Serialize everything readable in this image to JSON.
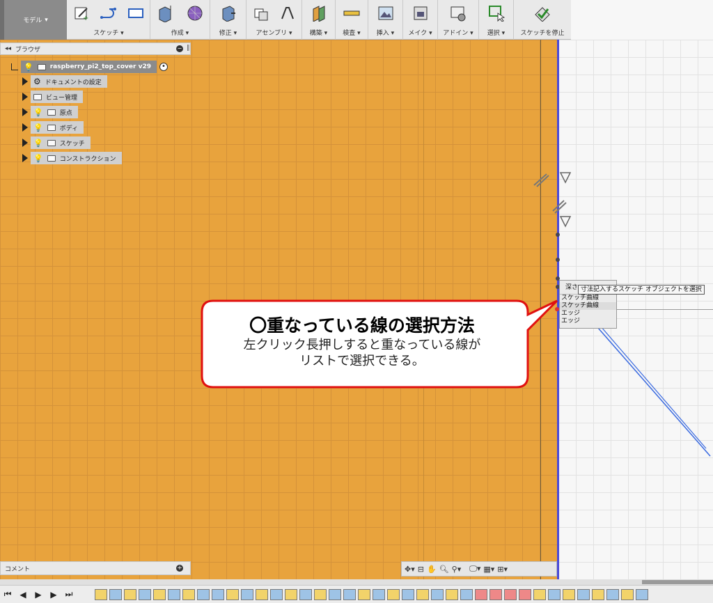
{
  "toolbar": {
    "workspace": "モデル",
    "groups": [
      {
        "label": "スケッチ"
      },
      {
        "label": "作成"
      },
      {
        "label": "修正"
      },
      {
        "label": "アセンブリ"
      },
      {
        "label": "構築"
      },
      {
        "label": "検査"
      },
      {
        "label": "挿入"
      },
      {
        "label": "メイク"
      },
      {
        "label": "アドイン"
      },
      {
        "label": "選択"
      },
      {
        "label": "スケッチを停止"
      }
    ],
    "menu_icon": "caret-down"
  },
  "browser": {
    "title": "ブラウザ",
    "root": "raspberry_pi2_top_cover v29",
    "items": [
      {
        "label": "ドキュメントの設定",
        "icon": "gear-icon"
      },
      {
        "label": "ビュー管理",
        "icon": "folder-icon"
      },
      {
        "label": "原点",
        "icon": "folder-icon"
      },
      {
        "label": "ボディ",
        "icon": "folder-icon"
      },
      {
        "label": "スケッチ",
        "icon": "folder-icon"
      },
      {
        "label": "コンストラクション",
        "icon": "folder-icon"
      }
    ]
  },
  "comments": {
    "title": "コメント"
  },
  "selection_list": {
    "header": "深さ",
    "items": [
      "スケッチ曲線",
      "スケッチ曲線",
      "エッジ",
      "エッジ"
    ]
  },
  "tooltip": "寸法記入するスケッチ オブジェクトを選択",
  "callout": {
    "title": "〇重なっている線の選択方法",
    "lines": [
      "左クリック長押しすると重なっている線が",
      "リストで選択できる。"
    ]
  },
  "colors": {
    "canvas": "#e8a33d",
    "callout_border": "#e01010",
    "sketch_line": "#4a4ad8"
  }
}
